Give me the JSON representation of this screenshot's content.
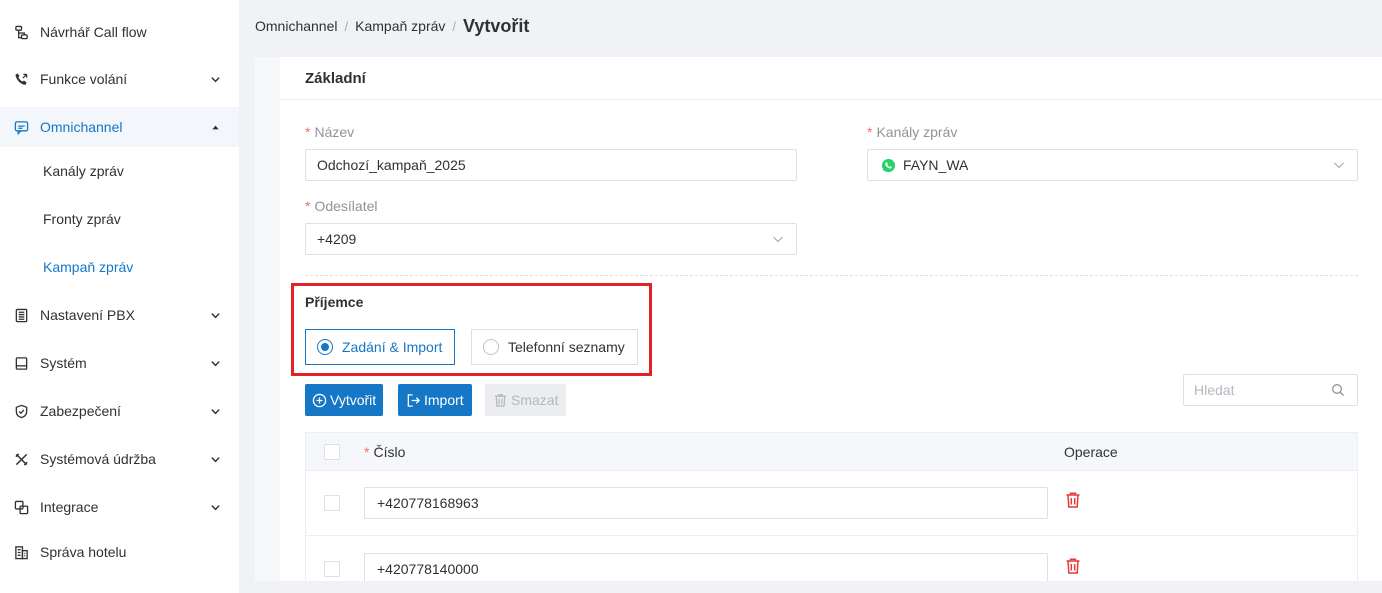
{
  "sidebar": {
    "items": [
      {
        "label": "Návrhář Call flow",
        "icon": "flow-designer-icon"
      },
      {
        "label": "Funkce volání",
        "icon": "phone-icon",
        "expandable": true
      },
      {
        "label": "Omnichannel",
        "icon": "chat-icon",
        "expandable": true,
        "expanded": true,
        "active": true
      },
      {
        "label": "Nastavení PBX",
        "icon": "pbx-settings-icon",
        "expandable": true
      },
      {
        "label": "Systém",
        "icon": "system-icon",
        "expandable": true
      },
      {
        "label": "Zabezpečení",
        "icon": "shield-icon",
        "expandable": true
      },
      {
        "label": "Systémová údržba",
        "icon": "tools-icon",
        "expandable": true
      },
      {
        "label": "Integrace",
        "icon": "integration-icon",
        "expandable": true
      },
      {
        "label": "Správa hotelu",
        "icon": "hotel-icon"
      }
    ],
    "subitems": [
      {
        "label": "Kanály zpráv"
      },
      {
        "label": "Fronty zpráv"
      },
      {
        "label": "Kampaň zpráv",
        "active": true
      }
    ]
  },
  "breadcrumb": {
    "items": [
      "Omnichannel",
      "Kampaň zpráv"
    ],
    "current": "Vytvořit",
    "separator": "/"
  },
  "form": {
    "section_title": "Základní",
    "required_mark": "*",
    "name_label": "Název",
    "name_value": "Odchozí_kampaň_2025",
    "channels_label": "Kanály zpráv",
    "channels_value": "FAYN_WA",
    "sender_label": "Odesílatel",
    "sender_value": "+4209"
  },
  "recipients": {
    "title": "Příjemce",
    "options": [
      {
        "label": "Zadání & Import",
        "checked": true
      },
      {
        "label": "Telefonní seznamy",
        "checked": false
      }
    ]
  },
  "toolbar": {
    "create_label": "Vytvořit",
    "import_label": "Import",
    "delete_label": "Smazat",
    "search_placeholder": "Hledat"
  },
  "table": {
    "required_mark": "*",
    "col_number": "Číslo",
    "col_operations": "Operace",
    "rows": [
      {
        "number": "+420778168963"
      },
      {
        "number": "+420778140000"
      }
    ]
  },
  "colors": {
    "accent": "#1677c7",
    "required": "#f56c6c",
    "highlight": "#e22323",
    "delete": "#e23b3b",
    "whatsapp": "#25d366"
  }
}
